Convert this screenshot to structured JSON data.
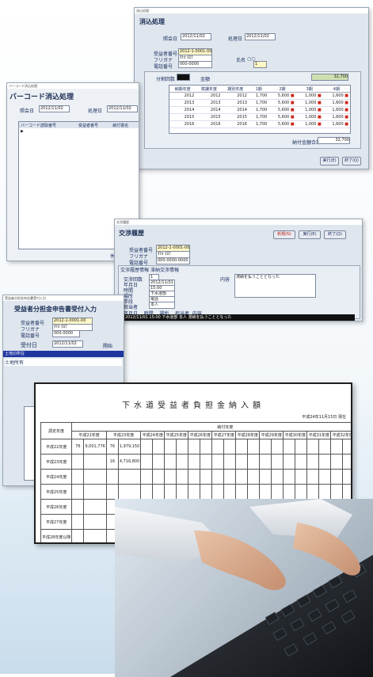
{
  "win1": {
    "caption": "消込処理",
    "title": "消込処理",
    "date_label": "照会日",
    "date_value": "2012/11/02",
    "process_label": "処理日",
    "process_value": "2012/11/02",
    "code_label": "受益者番号",
    "code_value": "2012-1-0001-00",
    "kana_label": "フリガナ",
    "kana_value": "ﾀﾅｶ ﾀﾛｳ",
    "tel_label": "電話番号",
    "tel_value": "000-0000",
    "name_label": "氏名",
    "name_value": "○○",
    "count_label": "分割回数",
    "count_value": "1",
    "amount_label": "金額",
    "amount_value": "32,700",
    "grid_headers": [
      "納期年度",
      "賦課年度",
      "期別年度",
      "1期",
      "2期",
      "3期",
      "4期"
    ],
    "grid_rows": [
      [
        "2012",
        "2012",
        "2012",
        "1,700",
        "5,600",
        "1,000",
        "1,600"
      ],
      [
        "2013",
        "2013",
        "2013",
        "1,700",
        "5,600",
        "1,000",
        "1,600"
      ],
      [
        "2014",
        "2014",
        "2014",
        "1,700",
        "5,600",
        "1,000",
        "1,600"
      ],
      [
        "2015",
        "2015",
        "2015",
        "1,700",
        "5,600",
        "1,000",
        "1,600"
      ],
      [
        "2016",
        "2016",
        "2016",
        "1,700",
        "5,600",
        "1,000",
        "1,600"
      ]
    ],
    "total_label": "納付金額合計",
    "total_value": "32,700",
    "btn_exec": "実行(E)",
    "btn_end": "終了(Q)"
  },
  "win2": {
    "caption": "バーコード消込処理",
    "title": "バーコード消込処理",
    "date_label": "照会日",
    "date_value": "2012/11/02",
    "process_label": "処理日",
    "process_value": "2012/11/02",
    "headers": [
      "バーコード読取番号",
      "受益者番号",
      "納付書名"
    ],
    "footer": "件 数"
  },
  "win3": {
    "caption": "交渉履歴",
    "title": "交渉履歴",
    "btn_new": "新規(N)",
    "btn_exec": "実行(E)",
    "btn_end": "終了(Q)",
    "code_label": "受益者番号",
    "code_value": "2012-1-0001-00",
    "kana_label": "フリガナ",
    "kana_value": "ﾀﾅｶ ﾀﾛｳ",
    "tel_label": "電話番号",
    "tel_value": "000-0000-0000",
    "tab_label": "交渉履歴情報",
    "tab2_label": "滞納交渉情報",
    "no_label": "交渉回数",
    "no_value": "1",
    "date_label": "年月日",
    "date_value": "2012/11/01",
    "time_label": "時間",
    "time_value": "15:00",
    "place_label": "場所",
    "place_value": "下水道部",
    "method_label": "手段",
    "method_value": "電話",
    "person_label": "担当者",
    "person_value": "本人",
    "content_label": "内容",
    "content_value": "滞納を払うこととなった",
    "list_headers": [
      "年月日",
      "時間",
      "場所",
      "担当者",
      "内容"
    ],
    "list_row": "2012/11/01  15:00  下水道部  本人  滞納を払うこととなった"
  },
  "win4": {
    "caption": "受益者分担金申告書受付入力",
    "title": "受益者分担金申告書受付入力",
    "code_label": "受益者番号",
    "code_value": "2012-1-0001-00",
    "kana_label": "フリガナ",
    "kana_value": "ﾀﾅｶ ﾀﾛｳ",
    "tel_label": "電話番号",
    "tel_value": "000-0000",
    "recv_label": "受付日",
    "recv_value": "2012/11/02",
    "open_label": "開始",
    "list": [
      "土地の所在",
      "土地所有"
    ]
  },
  "report": {
    "title": "下水道受益者負担金納入額",
    "date": "平成24年11月15日 現在",
    "col_year": "調定年度",
    "section": "納付年度",
    "years": [
      "平成22年度",
      "平成23年度",
      "平成24年度",
      "平成25年度",
      "平成26年度",
      "平成27年度",
      "平成28年度",
      "平成29年度",
      "平成30年度",
      "平成31年度",
      "平成32年度",
      "平成33年度"
    ],
    "right_head": "未納金額",
    "sub": [
      "件数",
      "金額"
    ],
    "rows": [
      {
        "label": "平成22年度",
        "cells": [
          "76",
          "9,001,776",
          "76",
          "1,979,150"
        ],
        "right": [
          "108",
          "7,504,000"
        ]
      },
      {
        "label": "平成23年度",
        "cells": [
          "",
          "",
          "16",
          "4,716,800"
        ],
        "right": [
          "37",
          "4,716,800"
        ]
      },
      {
        "label": "平成24年度",
        "cells": [
          "",
          "",
          "",
          ""
        ],
        "right": [
          "",
          ""
        ]
      },
      {
        "label": "平成25年度",
        "cells": [
          "",
          "",
          "",
          ""
        ],
        "right": [
          "",
          ""
        ]
      },
      {
        "label": "平成26年度",
        "cells": [
          "",
          "",
          "",
          ""
        ],
        "right": [
          "",
          ""
        ]
      },
      {
        "label": "平成27年度",
        "cells": [
          "",
          "",
          "",
          ""
        ],
        "right": [
          "",
          ""
        ]
      },
      {
        "label": "平成28年度以降",
        "cells": [
          "",
          "",
          "",
          ""
        ],
        "right": [
          "",
          ""
        ]
      },
      {
        "label": "計",
        "cells": [
          "76",
          "9,001,776",
          "",
          ""
        ],
        "right": [
          "",
          ""
        ]
      }
    ]
  },
  "photo": {
    "alt": "keyboard"
  }
}
